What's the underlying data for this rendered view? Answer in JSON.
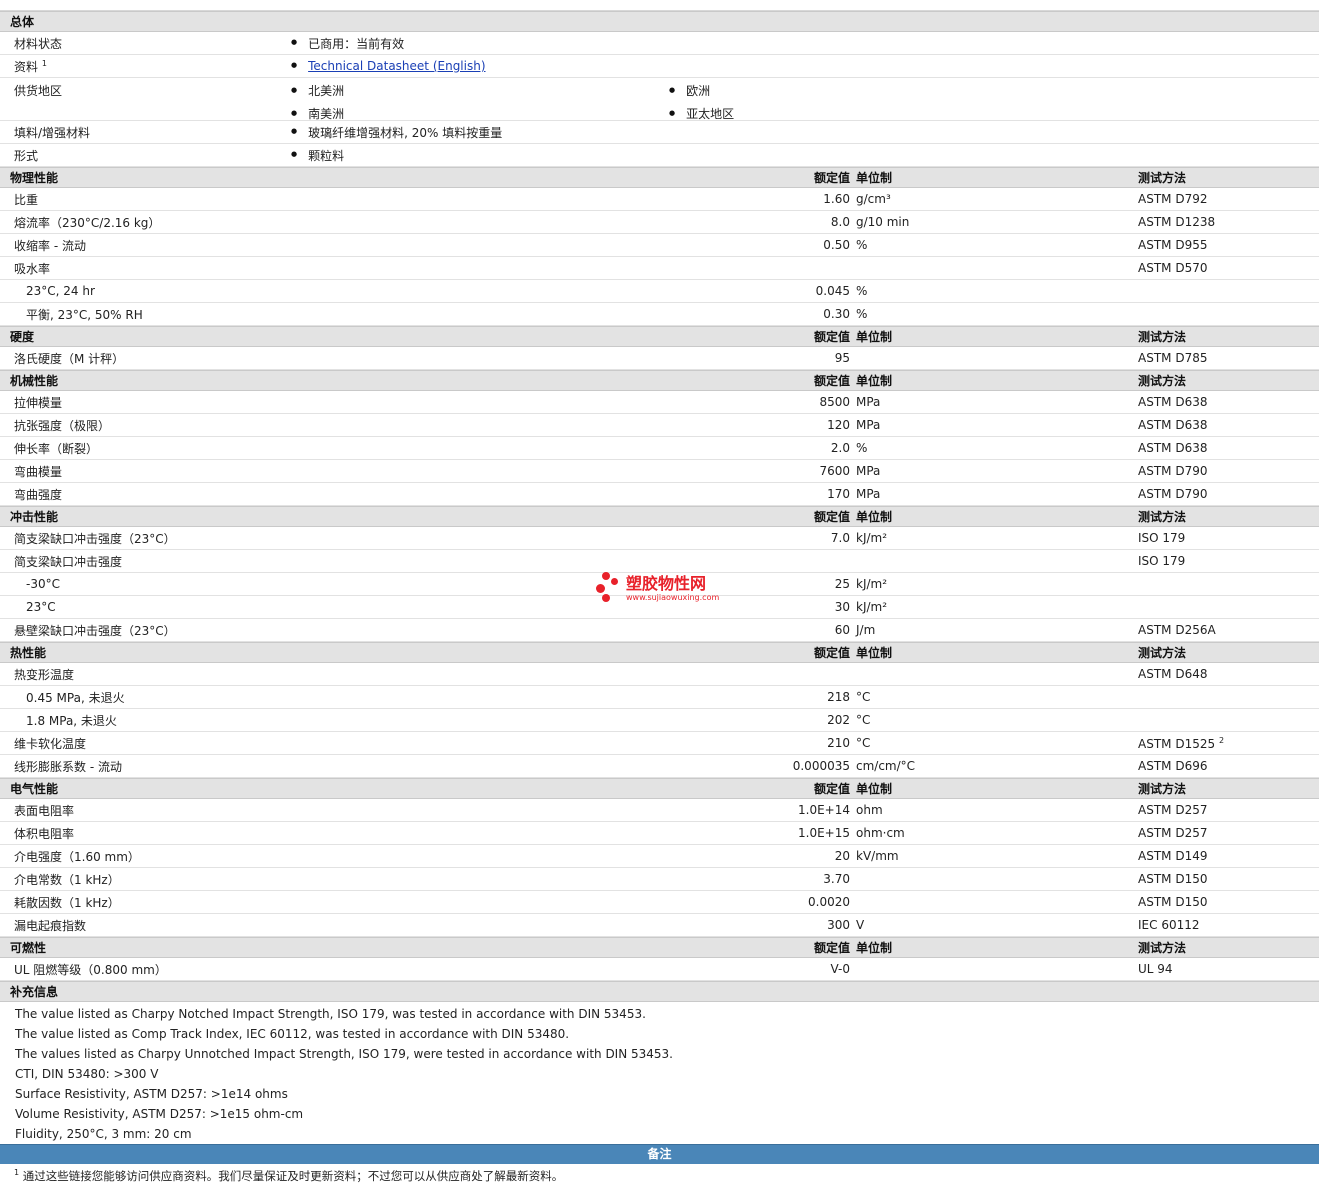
{
  "general": {
    "title": "总体",
    "rows": [
      {
        "name": "材料状态",
        "values": [
          "已商用：当前有效"
        ]
      },
      {
        "name": "资料",
        "sup": "1",
        "link": "Technical Datasheet (English)"
      },
      {
        "name": "供货地区",
        "values": [
          "北美洲",
          "欧洲",
          "南美洲",
          "亚太地区"
        ]
      },
      {
        "name": "填料/增强材料",
        "values": [
          "玻璃纤维增强材料, 20% 填料按重量"
        ]
      },
      {
        "name": "形式",
        "values": [
          "颗粒料"
        ]
      }
    ]
  },
  "col_headers": {
    "value": "额定值",
    "unit": "单位制",
    "test": "测试方法"
  },
  "sections": [
    {
      "title": "物理性能",
      "rows": [
        {
          "name": "比重",
          "value": "1.60",
          "unit": "g/cm³",
          "test": "ASTM D792"
        },
        {
          "name": "熔流率（230°C/2.16 kg）",
          "value": "8.0",
          "unit": "g/10 min",
          "test": "ASTM D1238"
        },
        {
          "name": "收缩率 - 流动",
          "value": "0.50",
          "unit": "%",
          "test": "ASTM D955"
        },
        {
          "name": "吸水率",
          "value": "",
          "unit": "",
          "test": "ASTM D570"
        },
        {
          "name": "23°C, 24 hr",
          "sub": true,
          "value": "0.045",
          "unit": "%",
          "test": ""
        },
        {
          "name": "平衡, 23°C, 50% RH",
          "sub": true,
          "value": "0.30",
          "unit": "%",
          "test": ""
        }
      ]
    },
    {
      "title": "硬度",
      "rows": [
        {
          "name": "洛氏硬度（M 计秤）",
          "value": "95",
          "unit": "",
          "test": "ASTM D785"
        }
      ]
    },
    {
      "title": "机械性能",
      "rows": [
        {
          "name": "拉伸模量",
          "value": "8500",
          "unit": "MPa",
          "test": "ASTM D638"
        },
        {
          "name": "抗张强度（极限）",
          "value": "120",
          "unit": "MPa",
          "test": "ASTM D638"
        },
        {
          "name": "伸长率（断裂）",
          "value": "2.0",
          "unit": "%",
          "test": "ASTM D638"
        },
        {
          "name": "弯曲模量",
          "value": "7600",
          "unit": "MPa",
          "test": "ASTM D790"
        },
        {
          "name": "弯曲强度",
          "value": "170",
          "unit": "MPa",
          "test": "ASTM D790"
        }
      ]
    },
    {
      "title": "冲击性能",
      "rows": [
        {
          "name": "简支梁缺口冲击强度（23°C）",
          "value": "7.0",
          "unit": "kJ/m²",
          "test": "ISO 179"
        },
        {
          "name": "简支梁缺口冲击强度",
          "value": "",
          "unit": "",
          "test": "ISO 179"
        },
        {
          "name": "-30°C",
          "sub": true,
          "value": "25",
          "unit": "kJ/m²",
          "test": ""
        },
        {
          "name": "23°C",
          "sub": true,
          "value": "30",
          "unit": "kJ/m²",
          "test": ""
        },
        {
          "name": "悬壁梁缺口冲击强度（23°C）",
          "value": "60",
          "unit": "J/m",
          "test": "ASTM D256A"
        }
      ]
    },
    {
      "title": "热性能",
      "rows": [
        {
          "name": "热变形温度",
          "value": "",
          "unit": "",
          "test": "ASTM D648"
        },
        {
          "name": "0.45 MPa, 未退火",
          "sub": true,
          "value": "218",
          "unit": "°C",
          "test": ""
        },
        {
          "name": "1.8 MPa, 未退火",
          "sub": true,
          "value": "202",
          "unit": "°C",
          "test": ""
        },
        {
          "name": "维卡软化温度",
          "value": "210",
          "unit": "°C",
          "test": "ASTM D1525",
          "test_sup": "2"
        },
        {
          "name": "线形膨胀系数 - 流动",
          "value": "0.000035",
          "unit": "cm/cm/°C",
          "test": "ASTM D696"
        }
      ]
    },
    {
      "title": "电气性能",
      "rows": [
        {
          "name": "表面电阻率",
          "value": "1.0E+14",
          "unit": "ohm",
          "test": "ASTM D257"
        },
        {
          "name": "体积电阻率",
          "value": "1.0E+15",
          "unit": "ohm·cm",
          "test": "ASTM D257"
        },
        {
          "name": "介电强度（1.60 mm）",
          "value": "20",
          "unit": "kV/mm",
          "test": "ASTM D149"
        },
        {
          "name": "介电常数（1 kHz）",
          "value": "3.70",
          "unit": "",
          "test": "ASTM D150"
        },
        {
          "name": "耗散因数（1 kHz）",
          "value": "0.0020",
          "unit": "",
          "test": "ASTM D150"
        },
        {
          "name": "漏电起痕指数",
          "value": "300",
          "unit": "V",
          "test": "IEC 60112"
        }
      ]
    },
    {
      "title": "可燃性",
      "rows": [
        {
          "name": "UL 阻燃等级（0.800 mm）",
          "value": "V-0",
          "unit": "",
          "test": "UL 94"
        }
      ]
    }
  ],
  "supplement": {
    "title": "补充信息",
    "lines": [
      "The value listed as Charpy Notched Impact Strength, ISO 179, was tested in accordance with DIN 53453.",
      "The value listed as Comp Track Index, IEC 60112, was tested in accordance with DIN 53480.",
      "The values listed as Charpy Unnotched Impact Strength, ISO 179, were tested in accordance with DIN 53453.",
      "CTI, DIN 53480: >300 V",
      "Surface Resistivity, ASTM D257: >1e14 ohms",
      "Volume Resistivity, ASTM D257: >1e15 ohm-cm",
      "Fluidity, 250°C, 3 mm: 20 cm"
    ]
  },
  "remarks": {
    "title": "备注",
    "footnote_num": "1",
    "footnote": "通过这些链接您能够访问供应商资料。我们尽量保证及时更新资料；不过您可以从供应商处了解最新资料。"
  },
  "watermark": {
    "cn": "塑胶物性网",
    "en": "www.sujiaowuxing.com",
    "color": "#e8212a"
  }
}
